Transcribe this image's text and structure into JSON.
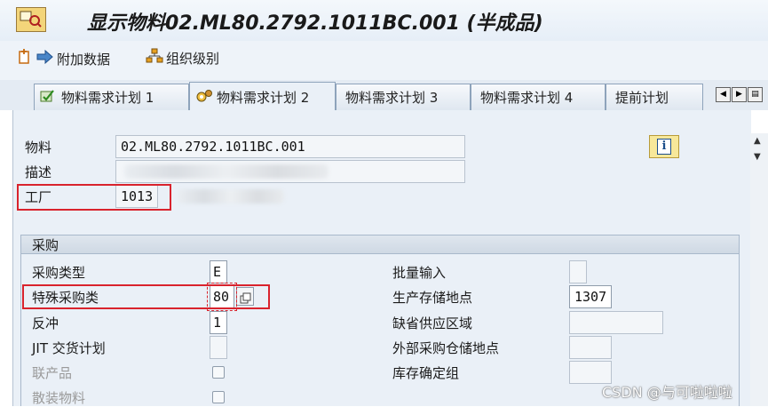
{
  "window": {
    "title": "显示物料02.ML80.2792.1011BC.001 (半成品)"
  },
  "toolbar": {
    "attach_data_label": "附加数据",
    "org_levels_label": "组织级别"
  },
  "tabs": [
    {
      "label": "物料需求计划 1",
      "icon": "check-icon"
    },
    {
      "label": "物料需求计划 2",
      "icon": "gears-icon",
      "active": true
    },
    {
      "label": "物料需求计划 3"
    },
    {
      "label": "物料需求计划 4"
    },
    {
      "label": "提前计划"
    }
  ],
  "header": {
    "material_label": "物料",
    "material_value": "02.ML80.2792.1011BC.001",
    "description_label": "描述",
    "plant_label": "工厂",
    "plant_value": "1013"
  },
  "procurement": {
    "group_title": "采购",
    "left": {
      "proc_type_label": "采购类型",
      "proc_type_value": "E",
      "special_proc_label": "特殊采购类",
      "special_proc_value": "80",
      "backflush_label": "反冲",
      "backflush_value": "1",
      "jit_label": "JIT 交货计划",
      "coproduct_label": "联产品",
      "bulk_label": "散装物料"
    },
    "right": {
      "batch_entry_label": "批量输入",
      "prod_sloc_label": "生产存储地点",
      "prod_sloc_value": "1307",
      "default_supply_label": "缺省供应区域",
      "ext_proc_sloc_label": "外部采购仓储地点",
      "stock_det_group_label": "库存确定组"
    }
  },
  "watermark": "CSDN @与可啦啦啦"
}
